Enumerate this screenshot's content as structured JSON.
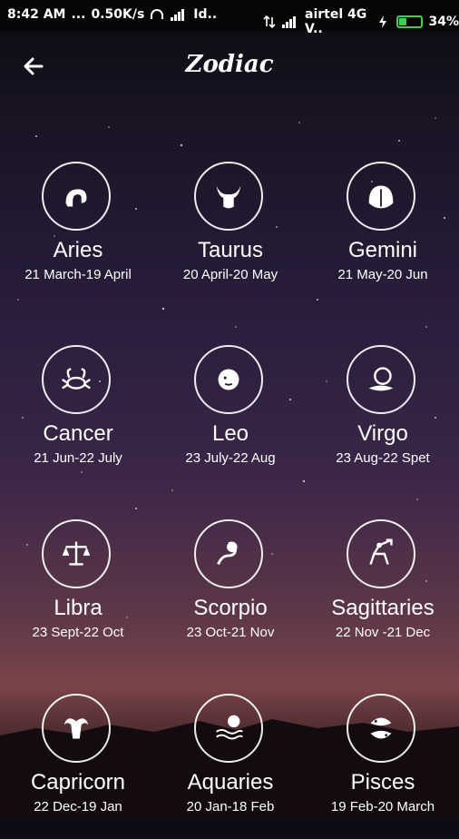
{
  "status_bar": {
    "time": "8:42 AM",
    "dots": "...",
    "speed": "0.50K/s",
    "sim1": "Id..",
    "carrier": "airtel 4G V..",
    "battery": "34%",
    "battery_level": 0.34,
    "battery_color": "#3ecf4a"
  },
  "header": {
    "title": "Zodiac",
    "back_icon": "arrow-left-icon"
  },
  "signs": [
    {
      "name": "Aries",
      "dates": "21 March-19 April",
      "icon": "ram-head-icon"
    },
    {
      "name": "Taurus",
      "dates": "20 April-20 May",
      "icon": "bull-head-icon"
    },
    {
      "name": "Gemini",
      "dates": "21 May-20 Jun",
      "icon": "twins-icon"
    },
    {
      "name": "Cancer",
      "dates": "21 Jun-22 July",
      "icon": "crab-icon"
    },
    {
      "name": "Leo",
      "dates": "23 July-22 Aug",
      "icon": "lion-icon"
    },
    {
      "name": "Virgo",
      "dates": "23 Aug-22 Spet",
      "icon": "maiden-icon"
    },
    {
      "name": "Libra",
      "dates": "23 Sept-22 Oct",
      "icon": "scales-icon"
    },
    {
      "name": "Scorpio",
      "dates": "23 Oct-21 Nov",
      "icon": "scorpion-icon"
    },
    {
      "name": "Sagittaries",
      "dates": "22 Nov -21 Dec",
      "icon": "archer-icon"
    },
    {
      "name": "Capricorn",
      "dates": "22 Dec-19 Jan",
      "icon": "goat-icon"
    },
    {
      "name": "Aquaries",
      "dates": "20 Jan-18 Feb",
      "icon": "water-bearer-icon"
    },
    {
      "name": "Pisces",
      "dates": "19 Feb-20 March",
      "icon": "fish-icon"
    }
  ]
}
